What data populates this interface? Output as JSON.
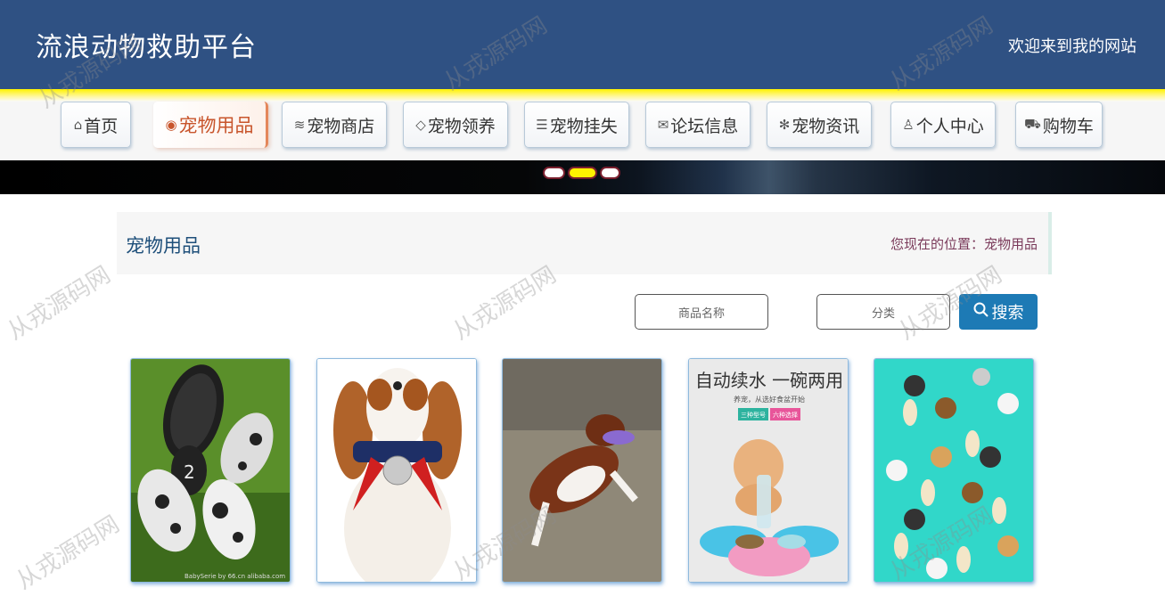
{
  "header": {
    "title": "流浪动物救助平台",
    "welcome": "欢迎来到我的网站"
  },
  "nav": [
    {
      "label": "首页",
      "icon": "home-icon"
    },
    {
      "label": "宠物用品",
      "icon": "palette-icon",
      "active": true
    },
    {
      "label": "宠物商店",
      "icon": "layers-icon"
    },
    {
      "label": "宠物领养",
      "icon": "tag-icon"
    },
    {
      "label": "宠物挂失",
      "icon": "sliders-icon"
    },
    {
      "label": "论坛信息",
      "icon": "message-icon"
    },
    {
      "label": "宠物资讯",
      "icon": "snowflake-icon"
    },
    {
      "label": "个人中心",
      "icon": "user-icon"
    },
    {
      "label": "购物车",
      "icon": "cart-icon"
    }
  ],
  "banner": {
    "slides": 3,
    "active_slide": 2
  },
  "breadcrumb": {
    "title": "宠物用品",
    "location_label": "您现在的位置：",
    "location_value": "宠物用品"
  },
  "search": {
    "name_placeholder": "商品名称",
    "category_placeholder": "分类",
    "button_label": "搜索"
  },
  "products": [
    {
      "image": "dog-shoes",
      "watermark": "BabySerie by 66.cn alibaba.com"
    },
    {
      "image": "dog-with-bell-collar"
    },
    {
      "image": "dog-catching-frisbee"
    },
    {
      "image": "water-feeder-bowl",
      "headline": "自动续水 一碗两用",
      "subline": "养宠，从选好食盆开始",
      "tag1": "三种型号",
      "tag2": "六种选择"
    },
    {
      "image": "dog-pattern-items"
    }
  ],
  "watermark_text": "从戎源码网",
  "colors": {
    "header": "#2f5183",
    "accent": "#1d7ab5",
    "active_nav": "#c8552c"
  }
}
